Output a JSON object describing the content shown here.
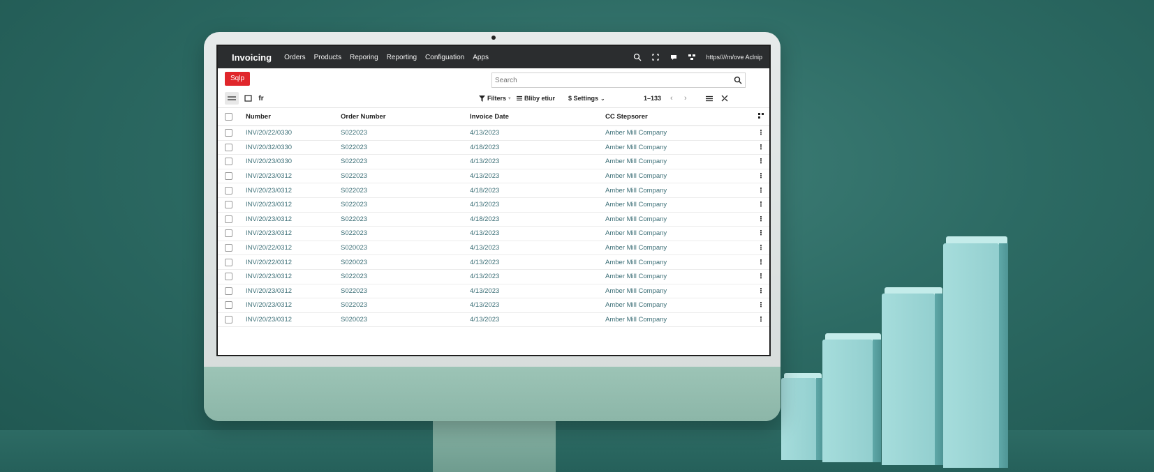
{
  "app": {
    "brand": "Invoicing",
    "nav": [
      "Orders",
      "Products",
      "Reporing",
      "Reporting",
      "Configuation",
      "Apps"
    ],
    "url": "https////m/ove Aclnip"
  },
  "control": {
    "new_label": "Sqlp",
    "search_placeholder": "Search",
    "view_label": "fr",
    "filters_label": "Filters",
    "groupby_label": "Bliby etiur",
    "settings_label": "$ Settings",
    "pager": "1–133"
  },
  "table": {
    "columns": [
      "Number",
      "Order Number",
      "Invoice Date",
      "CC Stepsorer"
    ],
    "rows": [
      [
        "INV/20/22/0330",
        "S022023",
        "4/13/2023",
        "Amber Mill Company"
      ],
      [
        "INV/20/32/0330",
        "S022023",
        "4/18/2023",
        "Amber Mill Company"
      ],
      [
        "INV/20/23/0330",
        "S022023",
        "4/13/2023",
        "Amber Mill Company"
      ],
      [
        "INV/20/23/0312",
        "S022023",
        "4/13/2023",
        "Amber Mill Company"
      ],
      [
        "INV/20/23/0312",
        "S022023",
        "4/18/2023",
        "Amber Mill Company"
      ],
      [
        "INV/20/23/0312",
        "S022023",
        "4/13/2023",
        "Amber Mill Company"
      ],
      [
        "INV/20/23/0312",
        "S022023",
        "4/18/2023",
        "Amber Mill Company"
      ],
      [
        "INV/20/23/0312",
        "S022023",
        "4/13/2023",
        "Amber Mill Company"
      ],
      [
        "INV/20/22/0312",
        "S020023",
        "4/13/2023",
        "Amber Mill Company"
      ],
      [
        "INV/20/22/0312",
        "S020023",
        "4/13/2023",
        "Amber Mill Company"
      ],
      [
        "INV/20/23/0312",
        "S022023",
        "4/13/2023",
        "Amber Mill Company"
      ],
      [
        "INV/20/23/0312",
        "S022023",
        "4/13/2023",
        "Amber Mill Company"
      ],
      [
        "INV/20/23/0312",
        "S022023",
        "4/13/2023",
        "Amber Mill Company"
      ],
      [
        "INV/20/23/0312",
        "S020023",
        "4/13/2023",
        "Amber Mill Company"
      ]
    ]
  },
  "colors": {
    "accent": "#e0262b",
    "navbar": "#2b2d2f",
    "link": "#3b6e76"
  }
}
